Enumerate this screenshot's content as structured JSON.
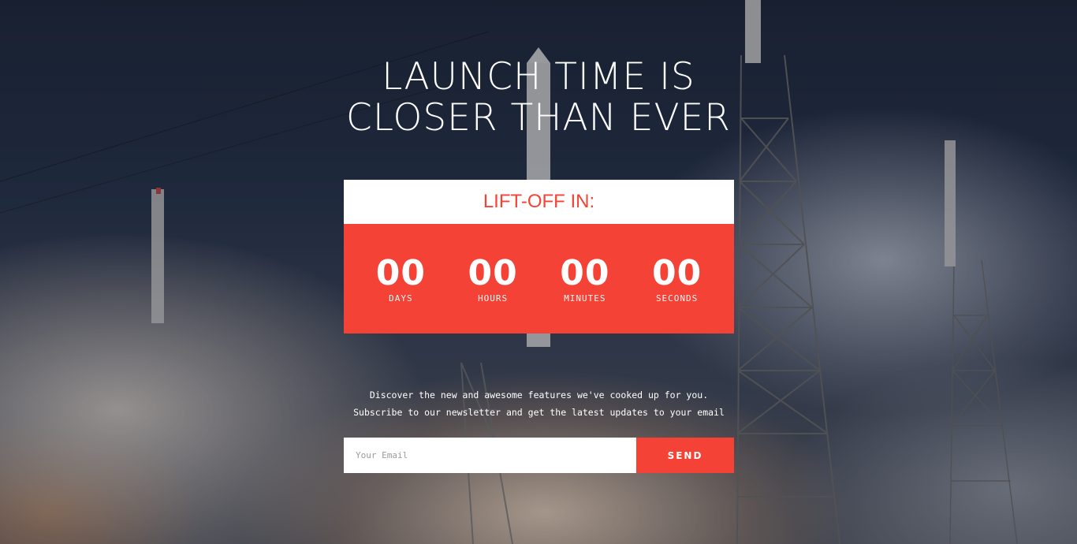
{
  "hero": {
    "title_line1": "LAUNCH TIME IS",
    "title_line2": "CLOSER THAN EVER"
  },
  "countdown": {
    "header": "LIFT-OFF IN:",
    "units": [
      {
        "value": "00",
        "label": "DAYS"
      },
      {
        "value": "00",
        "label": "HOURS"
      },
      {
        "value": "00",
        "label": "MINUTES"
      },
      {
        "value": "00",
        "label": "SECONDS"
      }
    ]
  },
  "newsletter": {
    "description": "Discover the new and awesome features we've cooked up for you. Subscribe to our newsletter and get the latest updates to your email",
    "email_placeholder": "Your Email",
    "email_value": "",
    "send_label": "SEND"
  },
  "colors": {
    "accent": "#f44336",
    "panel": "#ffffff",
    "text_light": "#ffffff"
  }
}
